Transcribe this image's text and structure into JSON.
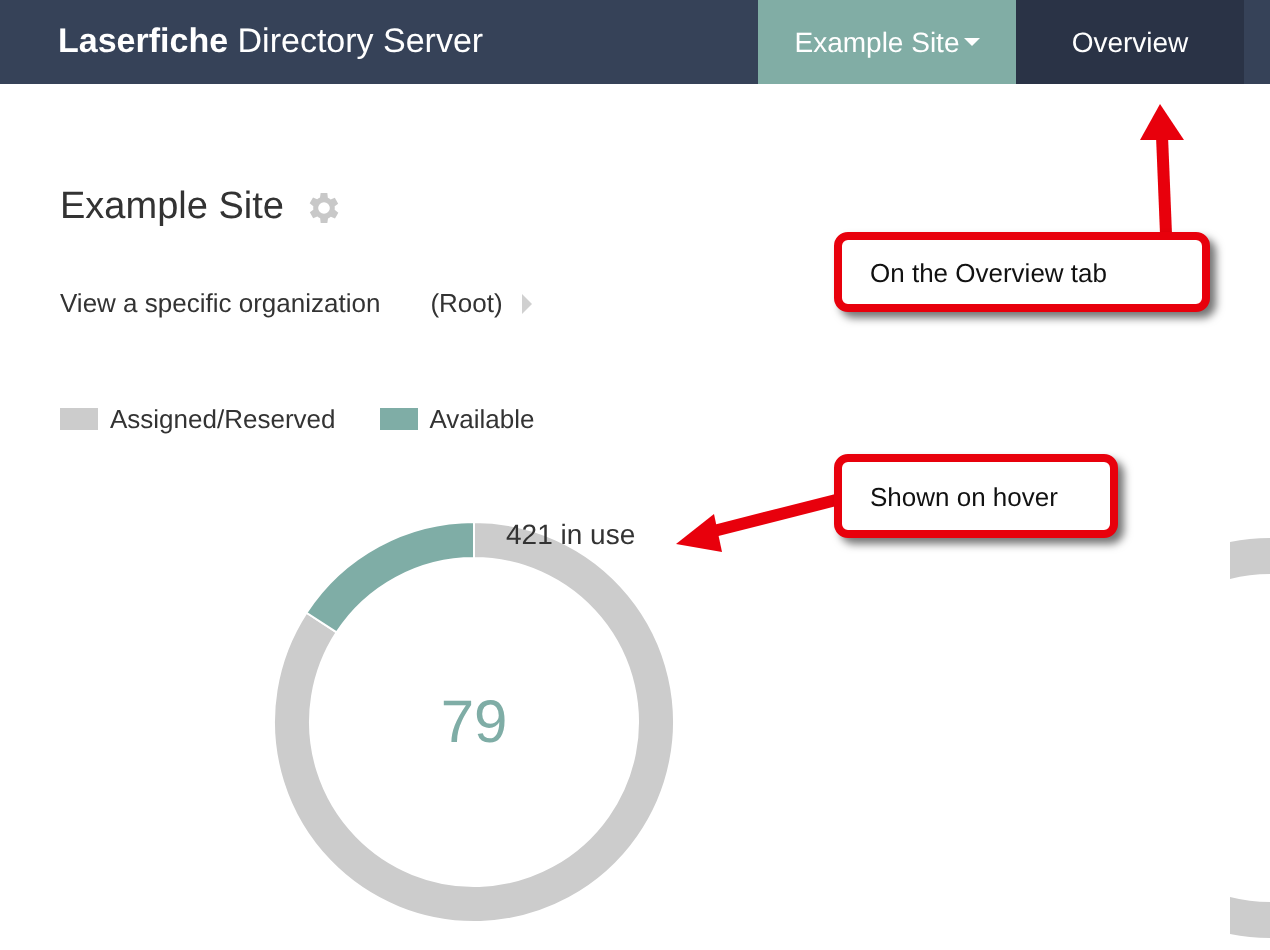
{
  "navbar": {
    "brand": "**Laserfiche** Directory Server",
    "items": [
      {
        "label": "Example Site",
        "kind": "dropdown",
        "selected": false
      },
      {
        "label": "Overview",
        "kind": "tab",
        "selected": true
      }
    ]
  },
  "page": {
    "title": "Example Site",
    "org_label": "View a specific organization",
    "org_value": "(Root)"
  },
  "legend": [
    {
      "color": "#cccccc"
    },
    {
      "color": "#7fada6"
    }
  ],
  "usage": {
    "center_label": "79",
    "hover_label": "421 in use",
    "chart_data": {
      "type": "donut",
      "categories": [
        "Assigned/Reserved",
        "Available"
      ],
      "values": [
        84.2,
        15.8
      ]
    }
  },
  "callouts": [
    {
      "text": "On the Overview tab"
    },
    {
      "text": "Shown on hover"
    }
  ]
}
